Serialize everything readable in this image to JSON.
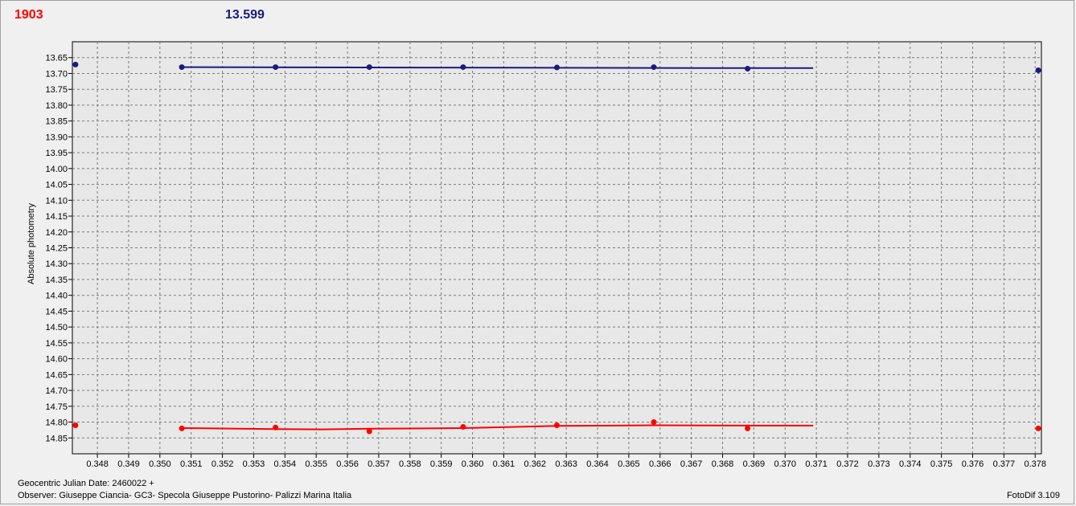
{
  "header": {
    "left_value": "1903",
    "right_value": "13.599"
  },
  "footer": {
    "date_label": "Geocentric Julian Date: 2460022 +",
    "observer": "Observer: Giuseppe Ciancia- GC3- Specola Giuseppe Pustorino- Palizzi Marina Italia",
    "software": "FotoDif 3.109"
  },
  "colors": {
    "series_1": "#1a1a80",
    "series_2": "#ff0000",
    "left_label": "#ff0000",
    "right_label": "#1a1a80"
  },
  "chart_data": {
    "type": "scatter",
    "title": "",
    "xlabel": "",
    "ylabel": "Absolute photometry",
    "xlim": [
      0.3472,
      0.3782
    ],
    "ylim": [
      13.6,
      14.9
    ],
    "y_inverted": true,
    "grid": true,
    "x_ticks": [
      "0.348",
      "0.349",
      "0.350",
      "0.351",
      "0.352",
      "0.353",
      "0.354",
      "0.355",
      "0.356",
      "0.357",
      "0.358",
      "0.359",
      "0.360",
      "0.361",
      "0.362",
      "0.363",
      "0.364",
      "0.365",
      "0.366",
      "0.367",
      "0.368",
      "0.369",
      "0.370",
      "0.371",
      "0.372",
      "0.373",
      "0.374",
      "0.375",
      "0.376",
      "0.377",
      "0.378"
    ],
    "y_ticks": [
      "13.65",
      "13.70",
      "13.75",
      "13.80",
      "13.85",
      "13.90",
      "13.95",
      "14.00",
      "14.05",
      "14.10",
      "14.15",
      "14.20",
      "14.25",
      "14.30",
      "14.35",
      "14.40",
      "14.45",
      "14.50",
      "14.55",
      "14.60",
      "14.65",
      "14.70",
      "14.75",
      "14.80",
      "14.85"
    ],
    "series": [
      {
        "points": [
          [
            0.3473,
            13.672
          ],
          [
            0.3507,
            13.68
          ],
          [
            0.3537,
            13.68
          ],
          [
            0.3567,
            13.68
          ],
          [
            0.3597,
            13.68
          ],
          [
            0.3627,
            13.681
          ],
          [
            0.3658,
            13.68
          ],
          [
            0.3688,
            13.685
          ],
          [
            0.3781,
            13.69
          ]
        ],
        "trend": [
          [
            0.3507,
            13.68
          ],
          [
            0.3567,
            13.681
          ],
          [
            0.3627,
            13.682
          ],
          [
            0.3688,
            13.683
          ],
          [
            0.3709,
            13.683
          ]
        ]
      },
      {
        "points": [
          [
            0.3473,
            14.81
          ],
          [
            0.3507,
            14.82
          ],
          [
            0.3537,
            14.817
          ],
          [
            0.3567,
            14.829
          ],
          [
            0.3597,
            14.815
          ],
          [
            0.3627,
            14.81
          ],
          [
            0.3658,
            14.8
          ],
          [
            0.3688,
            14.82
          ],
          [
            0.3781,
            14.82
          ]
        ],
        "trend": [
          [
            0.3507,
            14.819
          ],
          [
            0.3537,
            14.822
          ],
          [
            0.3552,
            14.823
          ],
          [
            0.3567,
            14.821
          ],
          [
            0.3597,
            14.819
          ],
          [
            0.3627,
            14.812
          ],
          [
            0.3658,
            14.81
          ],
          [
            0.3688,
            14.811
          ],
          [
            0.3709,
            14.811
          ]
        ]
      }
    ]
  }
}
